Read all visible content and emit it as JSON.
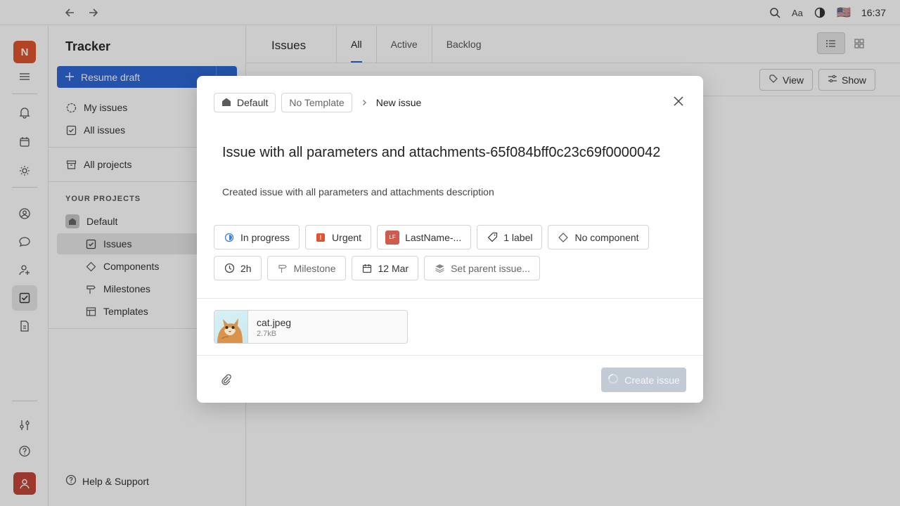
{
  "topbar": {
    "time": "16:37",
    "font_label": "Aa",
    "flag": "🇺🇸"
  },
  "rail": {
    "workspace_initial": "N"
  },
  "sidebar": {
    "title": "Tracker",
    "resume_label": "Resume draft",
    "my_issues": "My issues",
    "all_issues": "All issues",
    "all_projects": "All projects",
    "section": "YOUR PROJECTS",
    "project": "Default",
    "sub": [
      "Issues",
      "Components",
      "Milestones",
      "Templates"
    ],
    "help": "Help & Support"
  },
  "main": {
    "title": "Issues",
    "tabs": [
      "All",
      "Active",
      "Backlog"
    ],
    "view_btn": "View",
    "show_btn": "Show"
  },
  "modal": {
    "project_chip": "Default",
    "template_chip": "No Template",
    "crumb": "New issue",
    "title": "Issue with all parameters and attachments-65f084bff0c23c69f0000042",
    "description": "Created issue with all parameters and attachments description",
    "status": "In progress",
    "priority": "Urgent",
    "assignee_initials": "LF",
    "assignee": "LastName-...",
    "labels": "1 label",
    "component": "No component",
    "estimation": "2h",
    "milestone": "Milestone",
    "due_date": "12 Mar",
    "parent": "Set parent issue...",
    "attachment_name": "cat.jpeg",
    "attachment_size": "2.7kB",
    "create_label": "Create issue"
  },
  "colors": {
    "accent": "#2f68d6",
    "urgent": "#e0542f",
    "workspace": "#e0542f"
  }
}
